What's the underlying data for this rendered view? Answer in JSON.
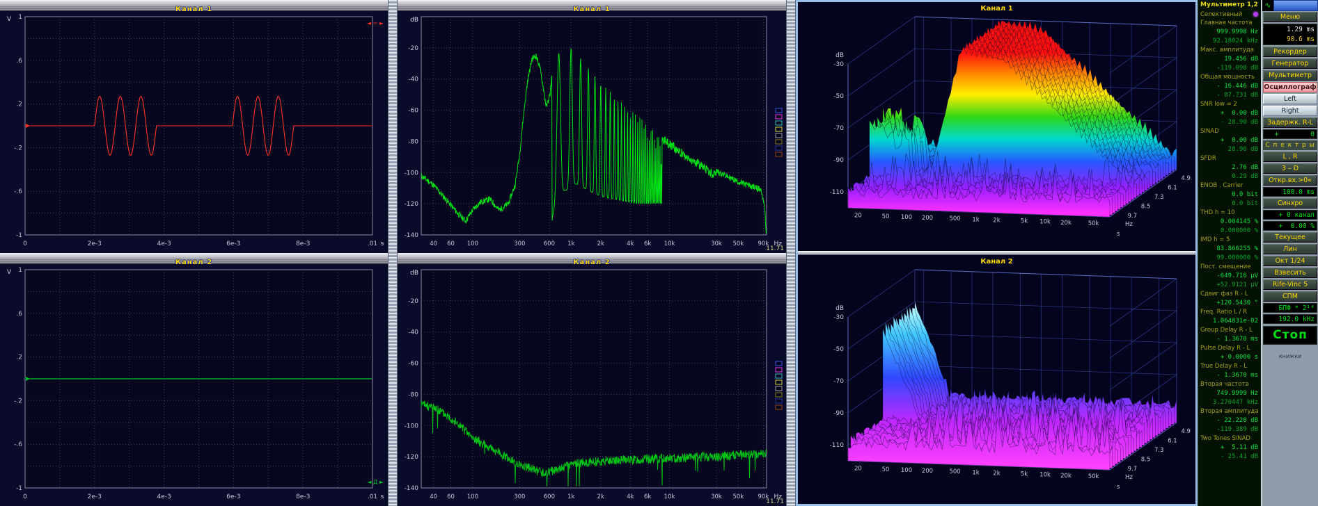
{
  "scope": {
    "y_unit": "V",
    "x_unit": "s",
    "y_ticks": [
      "1",
      ".6",
      ".2",
      "-.2",
      "-.6",
      "-1"
    ],
    "y_tick_values": [
      1,
      0.6,
      0.2,
      -0.2,
      -0.6,
      -1
    ],
    "x_ticks": [
      "0",
      "2e-3",
      "4e-3",
      "6e-3",
      "8e-3",
      ".01"
    ],
    "x_tick_values": [
      0,
      0.002,
      0.004,
      0.006,
      0.008,
      0.01
    ],
    "ch1": {
      "title": "Канал 1",
      "marker": "◄ = ►",
      "marker_pos": "top",
      "trace_color": "#ff3226",
      "signal": {
        "type": "tone_bursts",
        "amplitude": 0.27,
        "cycles": 3,
        "bursts": [
          {
            "t0": 0.002,
            "t1": 0.00378
          },
          {
            "t0": 0.00597,
            "t1": 0.00773
          }
        ]
      }
    },
    "ch2": {
      "title": "Канал 2",
      "marker": "◄ Д ►",
      "marker_pos": "bottom",
      "trace_color": "#00be2a",
      "signal": {
        "type": "flat",
        "level": 0
      }
    }
  },
  "spectrum": {
    "ch1_title": "Канал 1",
    "ch2_title": "Канал 2",
    "y_unit": "dB",
    "x_unit": "Hz",
    "readout": "11.71",
    "fmin": 30,
    "fmax": 97000,
    "y_ticks": [
      "-20",
      "-40",
      "-60",
      "-80",
      "-100",
      "-120",
      "-140"
    ],
    "y_tick_values": [
      -20,
      -40,
      -60,
      -80,
      -100,
      -120,
      -140
    ],
    "x_ticks": [
      "40",
      "60",
      "100",
      "300",
      "600",
      "1k",
      "2k",
      "4k",
      "6k",
      "10k",
      "30k",
      "50k",
      "90k"
    ],
    "x_tick_values": [
      40,
      60,
      100,
      300,
      600,
      1000,
      2000,
      4000,
      6000,
      10000,
      30000,
      50000,
      90000
    ],
    "legend_colors": [
      "#3858e8",
      "#e838e8",
      "#28c0c0",
      "#d8d838",
      "#a0a0a0",
      "#887818",
      "#283898",
      "#984818"
    ],
    "ch1": {
      "type": "comb",
      "color": "#00e414",
      "seed": 11,
      "jitter": 4,
      "floor": -131,
      "comb": {
        "start": 640,
        "end": 30000,
        "spacing": 250
      },
      "env": [
        [
          30,
          -102
        ],
        [
          40,
          -108
        ],
        [
          55,
          -118
        ],
        [
          70,
          -126
        ],
        [
          85,
          -131
        ],
        [
          100,
          -124
        ],
        [
          120,
          -119
        ],
        [
          150,
          -117
        ],
        [
          185,
          -124
        ],
        [
          230,
          -120
        ],
        [
          270,
          -108
        ],
        [
          300,
          -88
        ],
        [
          330,
          -62
        ],
        [
          360,
          -42
        ],
        [
          400,
          -27
        ],
        [
          440,
          -25
        ],
        [
          480,
          -32
        ],
        [
          520,
          -45
        ],
        [
          560,
          -58
        ],
        [
          610,
          -50
        ],
        [
          650,
          -33
        ],
        [
          700,
          -26
        ],
        [
          800,
          -21
        ],
        [
          900,
          -23
        ],
        [
          1000,
          -20
        ],
        [
          1150,
          -24
        ],
        [
          1300,
          -28
        ],
        [
          1500,
          -33
        ],
        [
          1800,
          -39
        ],
        [
          2200,
          -45
        ],
        [
          2700,
          -50
        ],
        [
          3300,
          -55
        ],
        [
          4000,
          -60
        ],
        [
          5000,
          -65
        ],
        [
          6500,
          -70
        ],
        [
          8000,
          -74
        ],
        [
          10000,
          -79
        ],
        [
          13000,
          -84
        ],
        [
          16000,
          -88
        ],
        [
          20000,
          -92
        ],
        [
          25000,
          -96
        ],
        [
          30000,
          -99
        ],
        [
          40000,
          -103
        ],
        [
          55000,
          -107
        ],
        [
          70000,
          -109
        ],
        [
          85000,
          -111
        ],
        [
          92000,
          -120
        ],
        [
          96000,
          -138
        ]
      ]
    },
    "ch2": {
      "type": "noisy",
      "color": "#00c214",
      "seed": 23,
      "jitter": 6,
      "dips": true,
      "env": [
        [
          30,
          -86
        ],
        [
          45,
          -90
        ],
        [
          60,
          -95
        ],
        [
          80,
          -102
        ],
        [
          100,
          -108
        ],
        [
          130,
          -112
        ],
        [
          170,
          -116
        ],
        [
          220,
          -120
        ],
        [
          300,
          -125
        ],
        [
          400,
          -128
        ],
        [
          550,
          -131
        ],
        [
          700,
          -128
        ],
        [
          900,
          -126
        ],
        [
          1200,
          -124
        ],
        [
          2000,
          -123
        ],
        [
          3000,
          -122
        ],
        [
          5000,
          -122
        ],
        [
          8000,
          -121
        ],
        [
          12000,
          -121
        ],
        [
          20000,
          -120
        ],
        [
          30000,
          -120
        ],
        [
          50000,
          -119
        ],
        [
          90000,
          -118
        ]
      ]
    }
  },
  "waterfall": {
    "common": {
      "y_unit": "dB",
      "x_unit": "Hz",
      "t_unit": "s",
      "db_ticks": [
        "-30",
        "-50",
        "-70",
        "-90",
        "-110"
      ],
      "freq_ticks": [
        "20",
        "50",
        "100",
        "200",
        "500",
        "1k",
        "2k",
        "5k",
        "10k",
        "20k",
        "50k"
      ],
      "freq_values": [
        20,
        50,
        100,
        200,
        500,
        1000,
        2000,
        5000,
        10000,
        20000,
        50000
      ],
      "time_ticks": [
        "4.9",
        "6.1",
        "7.3",
        "8.5",
        "9.7"
      ]
    },
    "ch1": {
      "title": "Канал 1",
      "kind": "mountain",
      "palette": [
        [
          0,
          "#ff1010"
        ],
        [
          0.13,
          "#ff8800"
        ],
        [
          0.26,
          "#ffee00"
        ],
        [
          0.4,
          "#30d818"
        ],
        [
          0.54,
          "#00d8d0"
        ],
        [
          0.68,
          "#2858ff"
        ],
        [
          0.84,
          "#9820ff"
        ],
        [
          1,
          "#ff30ff"
        ]
      ]
    },
    "ch2": {
      "title": "Канал 2",
      "kind": "ridge",
      "palette": [
        [
          0,
          "#c0ffff"
        ],
        [
          0.18,
          "#40c8ff"
        ],
        [
          0.45,
          "#3048ff"
        ],
        [
          0.72,
          "#c028ff"
        ],
        [
          1,
          "#ff40ff"
        ]
      ]
    }
  },
  "multimeter": {
    "title": "Мультиметр 1,2",
    "selective_label": "Селективный",
    "rows": [
      {
        "label": "Главная частота",
        "values": [
          "999.9998 Hz",
          "92.18024 kHz"
        ]
      },
      {
        "label": "Макс. амплитуда",
        "values": [
          "19.456 dB",
          "-119.098 dB"
        ]
      },
      {
        "label": "Общая мощность",
        "values": [
          "- 16.446 dB",
          "- 87.731 dB"
        ]
      },
      {
        "label": "SNR    low = 2",
        "values": [
          "+  0.00 dB",
          "- 28.90 dB"
        ]
      },
      {
        "label": "SINAD",
        "values": [
          "+  0.00 dB",
          "28.90 dB"
        ]
      },
      {
        "label": "SFDR",
        "values": [
          "2.76 dB",
          "0.29 dB"
        ]
      },
      {
        "label": "ENOB . Carrier",
        "values": [
          "0.0 bit",
          "0.0 bit"
        ]
      },
      {
        "label": "THD      h = 10",
        "values": [
          "0.004145 %",
          "0.000000 %"
        ]
      },
      {
        "label": "IMD      h =  5",
        "values": [
          "83.866255 %",
          "99.000000 %"
        ]
      },
      {
        "label": "Пост. смещение",
        "values": [
          "-649.716 µV",
          "+52.9121 µV"
        ]
      },
      {
        "label": "Сдвиг фаз R - L",
        "values": [
          "+120.5430 °"
        ]
      },
      {
        "label": "Freq. Ratio L / R",
        "values": [
          "1.064831e-02"
        ]
      },
      {
        "label": "Group Delay R - L",
        "values": [
          "- 1.3670 ms"
        ]
      },
      {
        "label": "Pulse Delay R - L",
        "values": [
          "+ 0.0000 s"
        ]
      },
      {
        "label": "True Delay R - L",
        "values": [
          "- 1.3670 ms"
        ]
      },
      {
        "label": "Вторая частота",
        "values": [
          "749.9999 Hz",
          "3.270447 kHz"
        ]
      },
      {
        "label": "Вторая амплитуда",
        "values": [
          "- 22.220 dB",
          "-119.389 dB"
        ]
      },
      {
        "label": "Two Tones SINAD",
        "values": [
          "+  5.11 dB",
          "- 25.41 dB"
        ]
      }
    ]
  },
  "controls": {
    "items": [
      {
        "type": "titlebar",
        "name": "ctrl-titlebar",
        "icon": "∿"
      },
      {
        "type": "button",
        "label": "Меню",
        "name": "menu-button"
      },
      {
        "type": "display2",
        "line1": "1.29 ms",
        "line2": "90.6 ms",
        "name": "time-readout-display"
      },
      {
        "type": "button",
        "label": "Рекордер",
        "name": "recorder-button"
      },
      {
        "type": "button",
        "label": "Генератор",
        "name": "generator-button"
      },
      {
        "type": "button",
        "label": "Мультиметр",
        "name": "multimeter-button"
      },
      {
        "type": "button-active",
        "label": "Осциллограф",
        "name": "oscilloscope-button"
      },
      {
        "type": "graybtn",
        "label": "Left",
        "name": "left-button"
      },
      {
        "type": "graybtn",
        "label": "Right",
        "name": "right-button"
      },
      {
        "type": "button",
        "label": "Задержк. R-L",
        "name": "delay-rl-button"
      },
      {
        "type": "value",
        "label": "+        0",
        "name": "delay-value-display"
      },
      {
        "type": "header",
        "label": "С п е к т р ы",
        "name": "spectra-header"
      },
      {
        "type": "button",
        "label": "L , R",
        "name": "spectra-lr-button"
      },
      {
        "type": "button",
        "label": "3 – D",
        "name": "spectra-3d-button"
      },
      {
        "type": "button",
        "label": "Откр.вх.>0«",
        "name": "open-input-button"
      },
      {
        "type": "display",
        "label": "100.0 ms",
        "name": "window-length-display"
      },
      {
        "type": "button",
        "label": "Синхро",
        "name": "sync-button"
      },
      {
        "type": "value",
        "label": "+ 0 канал",
        "name": "sync-channel-display"
      },
      {
        "type": "value",
        "label": "+  0.00 %",
        "name": "sync-level-display"
      },
      {
        "type": "button",
        "label": "Текущее",
        "name": "current-button"
      },
      {
        "type": "button",
        "label": "Лин",
        "name": "linear-button"
      },
      {
        "type": "button",
        "label": "Окт 1/24",
        "name": "octave-button"
      },
      {
        "type": "button",
        "label": "Взвесить",
        "name": "weighting-button"
      },
      {
        "type": "button",
        "label": "Rife-Vinc 5",
        "name": "window-function-button"
      },
      {
        "type": "button",
        "label": "СПМ",
        "name": "psd-button"
      },
      {
        "type": "display",
        "label": "БПФ * 2¹⁴",
        "name": "fft-size-display"
      },
      {
        "type": "display",
        "label": "192.0 kHz",
        "name": "sample-rate-display"
      },
      {
        "type": "stop",
        "label": "Стоп",
        "name": "stop-button"
      },
      {
        "type": "footer",
        "label": "книжки",
        "name": "footer-label"
      }
    ]
  }
}
